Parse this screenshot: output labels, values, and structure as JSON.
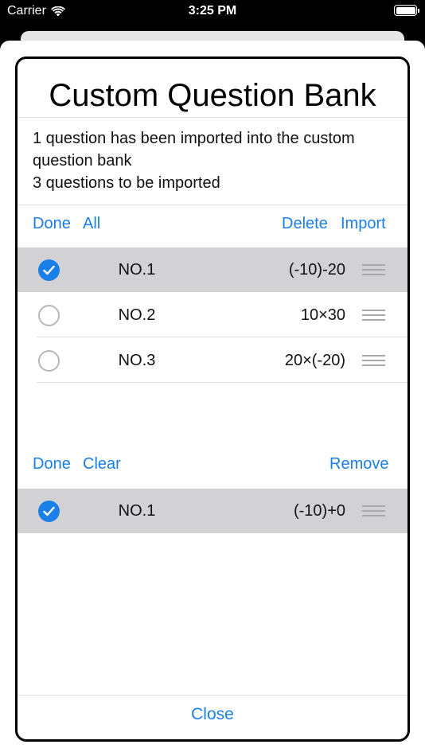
{
  "status_bar": {
    "carrier": "Carrier",
    "time": "3:25 PM"
  },
  "dialog": {
    "title": "Custom Question Bank",
    "info_line1": "1 question has been imported into the custom question bank",
    "info_line2": "3 questions to be imported",
    "close_label": "Close"
  },
  "pending": {
    "toolbar": {
      "done": "Done",
      "all": "All",
      "delete": "Delete",
      "import": "Import"
    },
    "rows": [
      {
        "no": "NO.1",
        "expr": "(-10)-20",
        "selected": true
      },
      {
        "no": "NO.2",
        "expr": "10×30",
        "selected": false
      },
      {
        "no": "NO.3",
        "expr": "20×(-20)",
        "selected": false
      }
    ]
  },
  "imported": {
    "toolbar": {
      "done": "Done",
      "clear": "Clear",
      "remove": "Remove"
    },
    "rows": [
      {
        "no": "NO.1",
        "expr": "(-10)+0",
        "selected": true
      }
    ]
  },
  "colors": {
    "accent": "#1a7fe6",
    "selected_row": "#d2d2d5"
  },
  "icons": [
    "wifi-icon",
    "battery-icon",
    "checkmark-icon",
    "drag-handle-icon"
  ]
}
